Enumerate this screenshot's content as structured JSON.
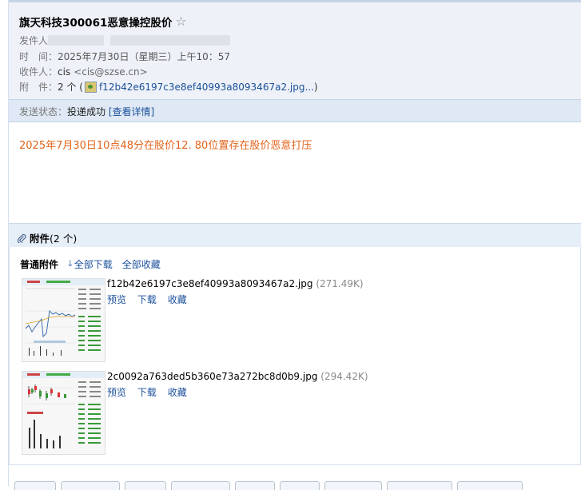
{
  "email": {
    "subject": "旗天科技300061恶意操控股价",
    "sender_label": "发件人",
    "time_label": "时　间：",
    "time_value": "2025年7月30日（星期三）上午10：57",
    "to_label": "收件人：",
    "to_name": "cis",
    "to_email": "<cis@szse.cn>",
    "attach_label": "附　件：",
    "attach_count": "2 个 (",
    "attach_first": "f12b42e6197c3e8ef40993a8093467a2.jpg...",
    "attach_close": ")",
    "status_label": "发送状态：",
    "status_value": "投递成功",
    "status_link": "[查看详情]",
    "body": "2025年7月30日10点48分在股价12. 80位置存在股价恶意打压"
  },
  "attachments": {
    "header_title": "附件",
    "header_count": "(2 个)",
    "section_label": "普通附件",
    "download_all": "全部下载",
    "save_all": "全部收藏",
    "items": [
      {
        "name": "f12b42e6197c3e8ef40993a8093467a2.jpg",
        "size": "(271.49K)",
        "preview": "预览",
        "download": "下载",
        "save": "收藏"
      },
      {
        "name": "2c0092a763ded5b360e73a272bc8d0b9.jpg",
        "size": "(294.42K)",
        "preview": "预览",
        "download": "下载",
        "save": "收藏"
      }
    ]
  },
  "icons": {
    "star": "star-outline-icon",
    "paperclip": "paperclip-icon",
    "download_arrow": "download-arrow-icon",
    "image_file": "image-file-icon"
  },
  "colors": {
    "link": "#1a4f9a",
    "body_text": "#e0631a",
    "header_bg": "#eef2f8",
    "status_bg": "#dfe8f4"
  }
}
